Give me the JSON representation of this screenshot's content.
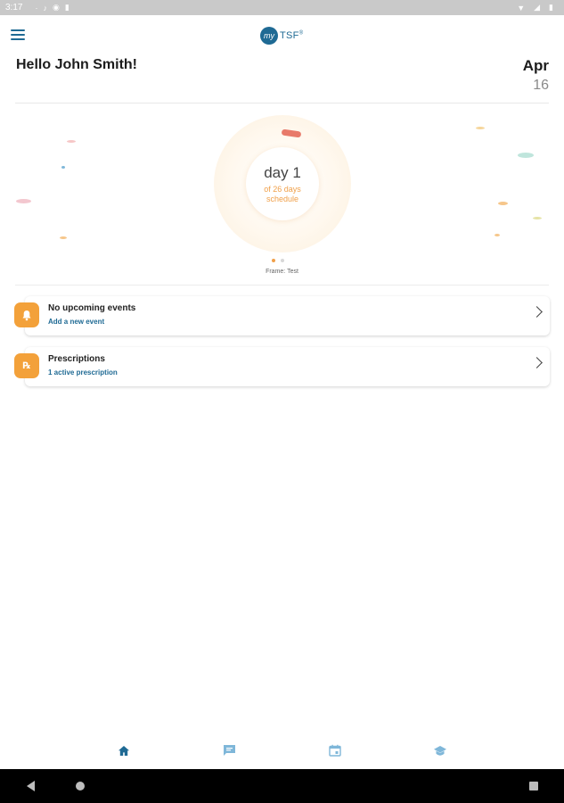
{
  "status_bar": {
    "time": "3:17",
    "left_icons": [
      "notification-dot-icon",
      "music-note-icon",
      "app-icon",
      "sd-card-icon"
    ],
    "right_icons": [
      "wifi-icon",
      "signal-icon",
      "battery-icon"
    ]
  },
  "app_bar": {
    "logo_prefix": "my",
    "logo_brand": "TSF",
    "logo_mark": "®"
  },
  "header": {
    "greeting": "Hello John Smith!",
    "date_month": "Apr",
    "date_day": "16"
  },
  "hero": {
    "day_label": "day 1",
    "schedule_line1": "of 26 days",
    "schedule_line2": "schedule",
    "caption": "Frame: Test",
    "page_count": 2,
    "active_page": 1
  },
  "cards": [
    {
      "title": "No upcoming events",
      "subtitle": "Add a new event",
      "icon": "bell-icon"
    },
    {
      "title": "Prescriptions",
      "subtitle": "1 active prescription",
      "icon": "prescription-icon"
    }
  ],
  "bottom_nav": [
    {
      "icon": "home-icon",
      "active": true
    },
    {
      "icon": "chat-icon",
      "active": false
    },
    {
      "icon": "calendar-icon",
      "active": false
    },
    {
      "icon": "education-icon",
      "active": false
    }
  ],
  "colors": {
    "primary": "#1f6a94",
    "accent": "#f3a13a",
    "accent_text": "#f0a04a",
    "ring_mark": "#e87a6a",
    "nav_inactive": "#7fb7d9"
  }
}
